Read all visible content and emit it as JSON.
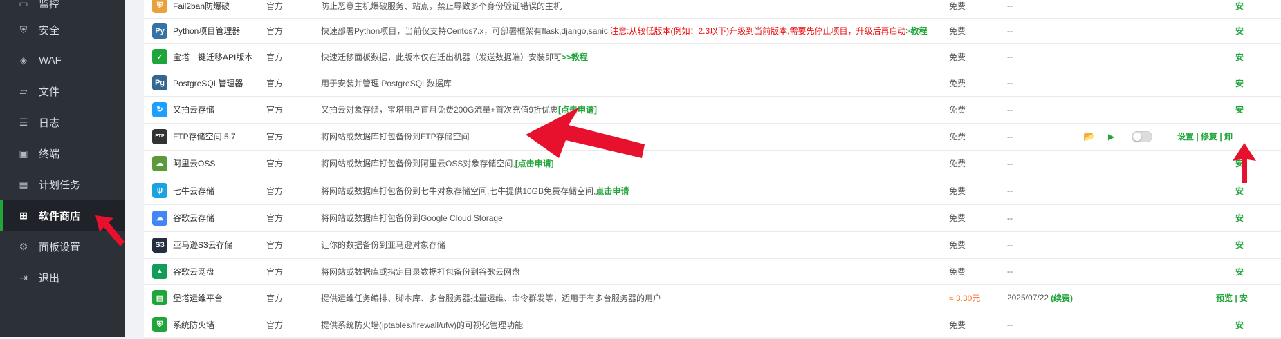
{
  "sidebar": {
    "items": [
      {
        "label": "监控",
        "icon": "monitor-icon",
        "glyph": "▭"
      },
      {
        "label": "安全",
        "icon": "shield-icon",
        "glyph": "⛨"
      },
      {
        "label": "WAF",
        "icon": "waf-shield-icon",
        "glyph": "◈"
      },
      {
        "label": "文件",
        "icon": "folder-icon",
        "glyph": "▱"
      },
      {
        "label": "日志",
        "icon": "log-icon",
        "glyph": "☰"
      },
      {
        "label": "终端",
        "icon": "terminal-icon",
        "glyph": "▣"
      },
      {
        "label": "计划任务",
        "icon": "calendar-icon",
        "glyph": "▦"
      },
      {
        "label": "软件商店",
        "icon": "app-grid-icon",
        "glyph": "⊞"
      },
      {
        "label": "面板设置",
        "icon": "gear-icon",
        "glyph": "⚙"
      },
      {
        "label": "退出",
        "icon": "logout-icon",
        "glyph": "⇥"
      }
    ]
  },
  "plugins": [
    {
      "name": "Fail2ban防爆破",
      "type": "官方",
      "desc": "防止恶意主机爆破服务、站点，禁止导致多个身份验证错误的主机",
      "price": "免费",
      "expire": "--",
      "action": "安",
      "icon": "fail2ban-icon",
      "glyph": "⛨",
      "color": "#e9a23b"
    },
    {
      "name": "Python项目管理器",
      "type": "官方",
      "desc": "快速部署Python项目，当前仅支持Centos7.x，可部署框架有flask,django,sanic,",
      "warn": "注意:从较低版本(例如：2.3以下)升级到当前版本,需要先停止项目，升级后再启动",
      "link": ">教程",
      "price": "免费",
      "expire": "--",
      "action": "安",
      "icon": "python-icon",
      "glyph": "Py",
      "color": "#3572a5"
    },
    {
      "name": "宝塔一键迁移API版本",
      "type": "官方",
      "desc": "快速迁移面板数据，此版本仅在迁出机器（发送数据端）安装即可",
      "link": ">>教程",
      "price": "免费",
      "expire": "--",
      "action": "安",
      "icon": "migrate-check-icon",
      "glyph": "✓",
      "color": "#20a53a"
    },
    {
      "name": "PostgreSQL管理器",
      "type": "官方",
      "desc": "用于安装并管理 PostgreSQL数据库",
      "price": "免费",
      "expire": "--",
      "action": "安",
      "icon": "postgresql-icon",
      "glyph": "Pg",
      "color": "#336791"
    },
    {
      "name": "又拍云存储",
      "type": "官方",
      "desc": "又拍云对象存储，宝塔用户首月免费200G流量+首次充值9折优惠",
      "link": "[点击申请]",
      "price": "免费",
      "expire": "--",
      "action": "安",
      "icon": "upyun-icon",
      "glyph": "↻",
      "color": "#1e9fff"
    },
    {
      "name": "FTP存储空间 5.7",
      "type": "官方",
      "desc": "将网站或数据库打包备份到FTP存储空间",
      "price": "免费",
      "expire": "--",
      "action": "设置 | 修复 | 卸",
      "installed": true,
      "icon": "ftp-icon",
      "glyph": "FTP",
      "color": "#333333"
    },
    {
      "name": "阿里云OSS",
      "type": "官方",
      "desc": "将网站或数据库打包备份到阿里云OSS对象存储空间,",
      "link": "[点击申请]",
      "price": "免费",
      "expire": "--",
      "action": "安",
      "icon": "aliyun-oss-icon",
      "glyph": "☁",
      "color": "#5b9a3b"
    },
    {
      "name": "七牛云存储",
      "type": "官方",
      "desc": "将网站或数据库打包备份到七牛对象存储空间,七牛提供10GB免费存储空间,",
      "link": "点击申请",
      "price": "免费",
      "expire": "--",
      "action": "安",
      "icon": "qiniu-icon",
      "glyph": "ψ",
      "color": "#1aa3e0"
    },
    {
      "name": "谷歌云存储",
      "type": "官方",
      "desc": "将网站或数据库打包备份到Google Cloud Storage",
      "price": "免费",
      "expire": "--",
      "action": "安",
      "icon": "google-cloud-icon",
      "glyph": "☁",
      "color": "#4285f4"
    },
    {
      "name": "亚马逊S3云存储",
      "type": "官方",
      "desc": "让你的数据备份到亚马逊对象存储",
      "price": "免费",
      "expire": "--",
      "action": "安",
      "icon": "aws-s3-icon",
      "glyph": "S3",
      "color": "#232f3e"
    },
    {
      "name": "谷歌云网盘",
      "type": "官方",
      "desc": "将网站或数据库或指定目录数据打包备份到谷歌云网盘",
      "price": "免费",
      "expire": "--",
      "action": "安",
      "icon": "google-drive-icon",
      "glyph": "▲",
      "color": "#0f9d58"
    },
    {
      "name": "堡塔运维平台",
      "type": "官方",
      "desc": "提供运维任务编排、脚本库、多台服务器批量运维、命令群发等，适用于有多台服务器的用户",
      "price": "≈ 3.30元",
      "paid": true,
      "expire": "2025/07/22",
      "renew": "(续费)",
      "action": "预览 | 安",
      "icon": "ops-platform-icon",
      "glyph": "▤",
      "color": "#20a53a"
    },
    {
      "name": "系统防火墙",
      "type": "官方",
      "desc": "提供系统防火墙(iptables/firewall/ufw)的可视化管理功能",
      "price": "免费",
      "expire": "--",
      "action": "安",
      "icon": "firewall-icon",
      "glyph": "⛨",
      "color": "#20a53a"
    }
  ],
  "colors": {
    "accent": "#20a53a",
    "warning": "#ef0808",
    "price": "#fc6d26",
    "arrow": "#e8112d"
  }
}
